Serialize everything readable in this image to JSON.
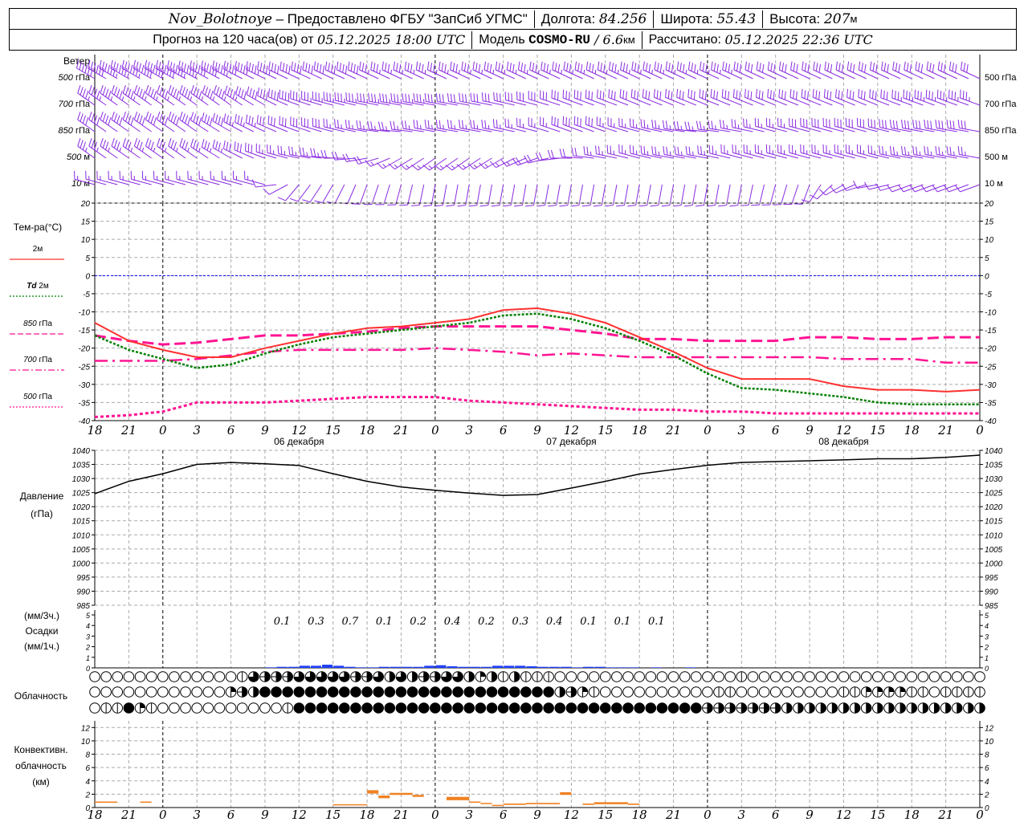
{
  "header": {
    "station": "Nov_Bolotnoye",
    "provider": " – Предоставлено ФГБУ \"ЗапСиб УГМС\"",
    "lon_label": "Долгота: ",
    "lon": "84.256",
    "lat_label": "Широта: ",
    "lat": "55.43",
    "alt_label": "Высота: ",
    "alt": "207",
    "alt_unit": "м",
    "forecast_prefix": "Прогноз на 120 часа(ов) от ",
    "forecast_time": "05.12.2025 18:00 UTC",
    "model_label": "Модель ",
    "model": "COSMO-RU",
    "model_sep": " / ",
    "res": "6.6",
    "res_unit": "км",
    "calc_label": "Рассчитано: ",
    "calc_time": "05.12.2025 22:36 UTC"
  },
  "colors": {
    "t2m": "#ff3030",
    "td2m": "#008000",
    "t850": "#ff1493",
    "t700": "#ff1493",
    "t500": "#ff1493",
    "wind": "#8a2be2",
    "precip": "#2040ff",
    "convective": "#f08020",
    "zero_line": "#0000ff"
  },
  "time_axis": {
    "labels": [
      "18",
      "21",
      "0",
      "3",
      "6",
      "9",
      "12",
      "15",
      "18",
      "21",
      "0",
      "3",
      "6",
      "9",
      "12",
      "15",
      "18",
      "21",
      "0",
      "3",
      "6",
      "9",
      "12",
      "15",
      "18",
      "21",
      "0"
    ],
    "day_labels": [
      {
        "text": "06 декабря",
        "hour": 18
      },
      {
        "text": "07 декабря",
        "hour": 42
      },
      {
        "text": "08 декабря",
        "hour": 66
      }
    ]
  },
  "wind": {
    "title": "Ветер",
    "levels": [
      {
        "label_num": "500",
        "label_unit": " гПа",
        "dir": [
          300,
          300,
          300,
          298,
          298,
          296,
          295,
          295,
          295,
          295,
          295,
          295,
          295,
          295,
          295,
          295,
          295,
          295,
          295,
          295,
          295,
          295,
          295,
          295,
          295,
          295,
          295
        ],
        "speed": [
          24,
          26,
          28,
          26,
          22,
          18,
          16,
          15,
          15,
          14,
          14,
          14,
          14,
          14,
          14,
          14,
          13,
          13,
          13,
          13,
          12,
          12,
          12,
          12,
          12,
          12,
          12
        ]
      },
      {
        "label_num": "700",
        "label_unit": " гПа",
        "dir": [
          305,
          305,
          305,
          305,
          305,
          300,
          290,
          285,
          282,
          280,
          280,
          280,
          282,
          285,
          290,
          290,
          292,
          292,
          292,
          292,
          292,
          292,
          292,
          292,
          290,
          290,
          290
        ],
        "speed": [
          18,
          18,
          18,
          18,
          18,
          16,
          15,
          14,
          14,
          13,
          13,
          12,
          12,
          12,
          12,
          12,
          12,
          12,
          12,
          12,
          12,
          12,
          12,
          12,
          13,
          13,
          13
        ]
      },
      {
        "label_num": "850",
        "label_unit": " гПа",
        "dir": [
          305,
          305,
          305,
          305,
          300,
          295,
          290,
          285,
          280,
          275,
          280,
          280,
          280,
          285,
          290,
          290,
          285,
          280,
          275,
          280,
          285,
          285,
          285,
          285,
          280,
          280,
          280
        ],
        "speed": [
          16,
          16,
          16,
          16,
          15,
          13,
          12,
          11,
          10,
          9,
          10,
          10,
          10,
          10,
          11,
          11,
          10,
          9,
          9,
          10,
          10,
          11,
          11,
          11,
          11,
          11,
          11
        ]
      },
      {
        "label_num": "500",
        "label_unit": " м",
        "dir": [
          305,
          305,
          305,
          305,
          300,
          290,
          282,
          275,
          260,
          240,
          235,
          235,
          240,
          250,
          270,
          280,
          285,
          280,
          280,
          285,
          285,
          285,
          285,
          285,
          280,
          280,
          280
        ],
        "speed": [
          14,
          14,
          14,
          14,
          13,
          11,
          10,
          9,
          8,
          6,
          6,
          6,
          6,
          7,
          8,
          9,
          9,
          9,
          9,
          10,
          10,
          10,
          10,
          10,
          10,
          10,
          10
        ]
      },
      {
        "label_num": "10",
        "label_unit": "  м",
        "dir": [
          285,
          285,
          285,
          285,
          285,
          285,
          220,
          210,
          200,
          195,
          190,
          190,
          190,
          190,
          190,
          190,
          190,
          190,
          190,
          190,
          195,
          200,
          240,
          260,
          250,
          250,
          250
        ],
        "speed": [
          5,
          5,
          5,
          5,
          5,
          5,
          3,
          3,
          3,
          3,
          3,
          3,
          3,
          3,
          3,
          3,
          3,
          3,
          3,
          3,
          3,
          3,
          4,
          4,
          4,
          4,
          4
        ]
      }
    ]
  },
  "chart_data": [
    {
      "type": "line",
      "ylabel": "Тем-ра(°С)",
      "ylim": [
        -40,
        20
      ],
      "yticks": [
        20,
        15,
        10,
        5,
        0,
        -5,
        -10,
        -15,
        -20,
        -25,
        -30,
        -35,
        -40
      ],
      "x_hours_from": "05.12.2025 18:00 UTC",
      "x": [
        0,
        3,
        6,
        9,
        12,
        15,
        18,
        21,
        24,
        27,
        30,
        33,
        36,
        39,
        42,
        45,
        48,
        51,
        54,
        57,
        60,
        63,
        66,
        69,
        72,
        75,
        78
      ],
      "grid": true,
      "series": [
        {
          "name": "2м",
          "key": "t2m",
          "style": "solid",
          "values": [
            -13,
            -18,
            -20.5,
            -22.5,
            -22.5,
            -20,
            -18,
            -16,
            -14.5,
            -14,
            -13,
            -12,
            -9.5,
            -9,
            -10.5,
            -13,
            -17,
            -21,
            -25.5,
            -28.5,
            -28.5,
            -28.5,
            -30.5,
            -31.5,
            -31.5,
            -32,
            -31.5
          ]
        },
        {
          "name": "Td  2м",
          "name_main": "Td",
          "name_sub": "  2м",
          "key": "td2m",
          "style": "dotted",
          "values": [
            -16.5,
            -20.5,
            -23,
            -25.5,
            -24.5,
            -21.5,
            -19,
            -17,
            -16,
            -15,
            -14,
            -13,
            -11,
            -10.5,
            -12,
            -14.5,
            -18,
            -22,
            -27,
            -31,
            -31.5,
            -32.5,
            -33.5,
            -35,
            -35.5,
            -35.5,
            -35.5
          ]
        },
        {
          "name": "850 гПа",
          "name_main": "850",
          "name_sub": " гПа",
          "key": "t850",
          "style": "dashed",
          "values": [
            -16.5,
            -18,
            -19,
            -18.5,
            -17.5,
            -16.5,
            -16.5,
            -16,
            -15.5,
            -14.5,
            -14,
            -14,
            -14,
            -14,
            -15,
            -16,
            -17.5,
            -17.5,
            -18,
            -18,
            -18,
            -17,
            -17,
            -17.5,
            -17.5,
            -17,
            -17
          ]
        },
        {
          "name": "700 гПа",
          "name_main": "700",
          "name_sub": " гПа",
          "key": "t700",
          "style": "dashdot",
          "values": [
            -23.5,
            -23.5,
            -23.5,
            -23,
            -22,
            -21,
            -20.5,
            -20.5,
            -20.5,
            -20.5,
            -20,
            -20.5,
            -21,
            -22,
            -21.5,
            -22,
            -22.5,
            -22.5,
            -22.5,
            -22.5,
            -22.5,
            -22.5,
            -23,
            -23,
            -23,
            -24,
            -24
          ]
        },
        {
          "name": "500 гПа",
          "name_main": "500",
          "name_sub": " гПа",
          "key": "t500",
          "style": "dotted-thick",
          "values": [
            -39,
            -38.5,
            -37.5,
            -35,
            -35,
            -35,
            -34.5,
            -34,
            -33.5,
            -33.5,
            -33.5,
            -34.5,
            -35,
            -35.5,
            -36,
            -36.5,
            -37,
            -37,
            -37.5,
            -37.5,
            -38,
            -38,
            -38,
            -38,
            -38,
            -38,
            -38
          ]
        }
      ]
    },
    {
      "type": "line",
      "ylabel": "Давление",
      "ylabel2": "(гПа)",
      "ylim": [
        985,
        1040
      ],
      "yticks": [
        1040,
        1035,
        1030,
        1025,
        1020,
        1015,
        1010,
        1005,
        1000,
        995,
        990,
        985
      ],
      "x": [
        0,
        3,
        6,
        9,
        12,
        15,
        18,
        21,
        24,
        27,
        30,
        33,
        36,
        39,
        42,
        45,
        48,
        51,
        54,
        57,
        60,
        63,
        66,
        69,
        72,
        75,
        78
      ],
      "grid": true,
      "values": [
        1024.6,
        1029,
        1031.7,
        1035,
        1035.7,
        1035.2,
        1034.6,
        1031.7,
        1029,
        1027,
        1025.8,
        1024.8,
        1024,
        1024.3,
        1026.6,
        1029,
        1031.6,
        1033.2,
        1034.7,
        1035.7,
        1036,
        1036.3,
        1036.6,
        1037,
        1037,
        1037.5,
        1038.3
      ]
    },
    {
      "type": "bar",
      "ylabel_top": "(мм/3ч.)",
      "ylabel": "Осадки",
      "ylabel_bottom": "(мм/1ч.)",
      "ylim": [
        0,
        5
      ],
      "yticks": [
        5,
        4,
        3,
        2,
        1,
        0
      ],
      "hourly_values": [
        0,
        0,
        0,
        0,
        0,
        0,
        0,
        0,
        0,
        0,
        0,
        0,
        0,
        0,
        0,
        0.05,
        0.1,
        0.1,
        0.2,
        0.2,
        0.3,
        0.2,
        0.1,
        0.05,
        0.05,
        0.1,
        0.1,
        0.1,
        0.1,
        0.2,
        0.25,
        0.15,
        0.1,
        0.1,
        0.1,
        0.2,
        0.2,
        0.2,
        0.15,
        0.1,
        0.1,
        0.1,
        0.05,
        0.1,
        0.1,
        0.05,
        0.05,
        0.05,
        0,
        0.05,
        0,
        0,
        0.05,
        0,
        0,
        0,
        0,
        0,
        0,
        0,
        0,
        0,
        0,
        0,
        0,
        0,
        0,
        0,
        0,
        0,
        0,
        0,
        0,
        0,
        0,
        0,
        0,
        0
      ],
      "sums_3h": [
        {
          "start_hour": 15,
          "value": "0.1"
        },
        {
          "start_hour": 18,
          "value": "0.3"
        },
        {
          "start_hour": 21,
          "value": "0.7"
        },
        {
          "start_hour": 24,
          "value": "0.1"
        },
        {
          "start_hour": 27,
          "value": "0.2"
        },
        {
          "start_hour": 30,
          "value": "0.4"
        },
        {
          "start_hour": 33,
          "value": "0.2"
        },
        {
          "start_hour": 36,
          "value": "0.3"
        },
        {
          "start_hour": 39,
          "value": "0.4"
        },
        {
          "start_hour": 42,
          "value": "0.1"
        },
        {
          "start_hour": 45,
          "value": "0.1"
        },
        {
          "start_hour": 48,
          "value": "0.1"
        }
      ]
    },
    {
      "type": "table",
      "ylabel": "Облачность",
      "units": "oktas",
      "rows": [
        [
          0,
          0,
          0,
          0,
          0,
          0,
          0,
          0,
          0,
          0,
          0,
          0,
          0,
          1,
          6,
          5,
          5,
          5,
          6,
          6,
          6,
          6,
          6,
          5,
          5,
          6,
          4,
          6,
          4,
          5,
          5,
          6,
          6,
          4,
          2,
          4,
          1,
          4,
          1,
          1,
          1,
          0,
          0,
          0,
          0,
          0,
          0,
          0,
          0,
          0,
          0,
          0,
          0,
          0,
          0,
          0,
          0,
          1,
          0,
          0,
          0,
          0,
          0,
          0,
          0,
          0,
          0,
          0,
          0,
          0,
          0,
          0,
          0,
          0,
          0,
          0,
          0,
          0,
          0
        ],
        [
          0,
          0,
          0,
          0,
          0,
          0,
          0,
          0,
          0,
          0,
          0,
          0,
          2,
          5,
          4,
          8,
          8,
          8,
          8,
          8,
          8,
          8,
          8,
          8,
          8,
          8,
          8,
          8,
          8,
          8,
          8,
          8,
          8,
          8,
          8,
          8,
          8,
          8,
          8,
          8,
          8,
          4,
          5,
          2,
          1,
          0,
          0,
          0,
          0,
          0,
          0,
          0,
          0,
          0,
          0,
          1,
          1,
          0,
          0,
          0,
          0,
          0,
          0,
          0,
          0,
          0,
          1,
          1,
          2,
          2,
          2,
          2,
          1,
          1,
          0,
          1,
          1,
          1,
          1
        ],
        [
          0,
          1,
          1,
          8,
          2,
          1,
          0,
          0,
          0,
          0,
          0,
          0,
          0,
          0,
          0,
          0,
          0,
          1,
          8,
          8,
          8,
          8,
          8,
          8,
          8,
          8,
          8,
          8,
          8,
          8,
          8,
          8,
          8,
          8,
          8,
          8,
          8,
          8,
          8,
          8,
          8,
          8,
          8,
          8,
          8,
          8,
          8,
          8,
          8,
          8,
          8,
          8,
          8,
          8,
          5,
          5,
          5,
          5,
          5,
          5,
          5,
          4,
          4,
          4,
          4,
          4,
          4,
          4,
          4,
          4,
          4,
          4,
          4,
          4,
          4,
          4,
          4,
          4,
          4
        ]
      ]
    },
    {
      "type": "bar",
      "ylabel": "Конвективн.",
      "ylabel2": "облачность",
      "ylabel3": "(км)",
      "ylim": [
        0,
        13
      ],
      "yticks": [
        12,
        10,
        8,
        6,
        4,
        2,
        0
      ],
      "segments_hours_base_top_km": [
        [
          0,
          2,
          0.8,
          0.9
        ],
        [
          4,
          5,
          0.8,
          0.9
        ],
        [
          21,
          24,
          0.4,
          0.5
        ],
        [
          24,
          25,
          2.1,
          2.6
        ],
        [
          25,
          26,
          1.4,
          1.8
        ],
        [
          26,
          28,
          1.9,
          2.2
        ],
        [
          28,
          29,
          1.6,
          1.9
        ],
        [
          31,
          33,
          1.1,
          1.6
        ],
        [
          33,
          34,
          0.8,
          0.9
        ],
        [
          34,
          35,
          0.6,
          0.7
        ],
        [
          35,
          36,
          0.3,
          0.4
        ],
        [
          36,
          38,
          0.4,
          0.6
        ],
        [
          38,
          41,
          0.5,
          0.7
        ],
        [
          41,
          42,
          1.9,
          2.3
        ],
        [
          43,
          44,
          0.4,
          0.6
        ],
        [
          44,
          47,
          0.5,
          0.8
        ],
        [
          47,
          48,
          0.4,
          0.6
        ]
      ]
    }
  ]
}
